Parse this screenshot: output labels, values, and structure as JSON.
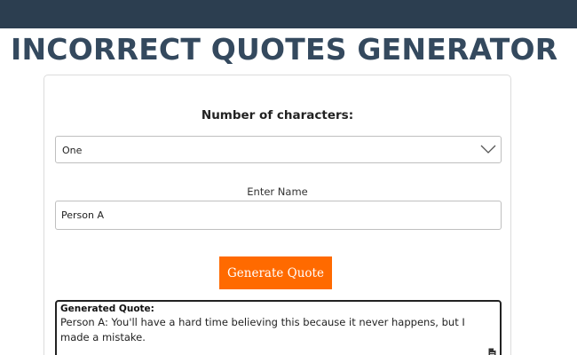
{
  "page": {
    "title": "INCORRECT QUOTES GENERATOR"
  },
  "form": {
    "characters_label": "Number of characters:",
    "characters_selected": "One",
    "name_label": "Enter Name",
    "name_value": "Person A",
    "generate_label": "Generate Quote"
  },
  "result": {
    "heading": "Generated Quote:",
    "text": "Person A: You'll have a hard time believing this because it never happens, but I made a mistake."
  },
  "colors": {
    "topbar": "#2c3e50",
    "title": "#34495e",
    "button": "#ff6a00"
  },
  "icons": {
    "select": "chevron-down-icon",
    "copy": "copy-icon"
  }
}
